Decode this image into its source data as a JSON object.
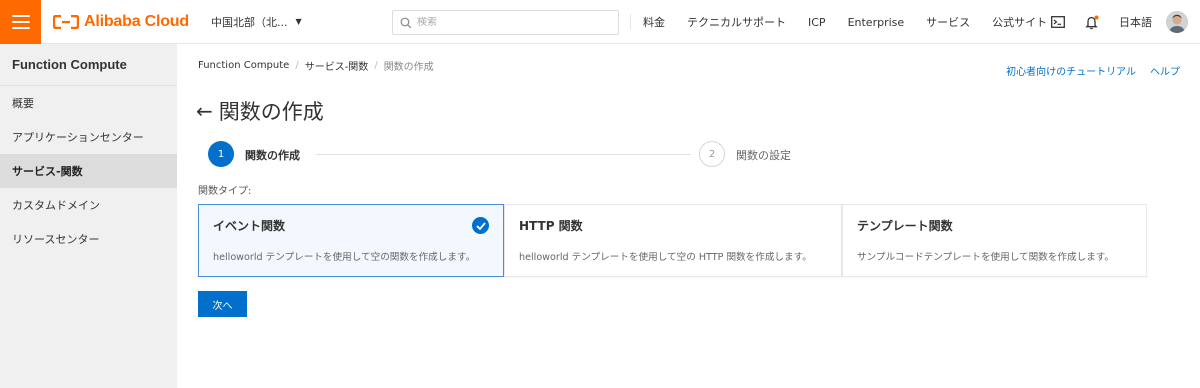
{
  "header": {
    "brand": "Alibaba Cloud",
    "region": "中国北部（北...",
    "search_placeholder": "検索",
    "nav": [
      "料金",
      "テクニカルサポート",
      "ICP",
      "Enterprise",
      "サービス",
      "公式サイト"
    ],
    "language": "日本語",
    "icons": [
      "menu-icon",
      "terminal-icon",
      "bell-icon",
      "avatar"
    ],
    "brand_color": "#ff6a00",
    "notification_dot_color": "#ff6a00"
  },
  "sidebar": {
    "title": "Function Compute",
    "items": [
      {
        "label": "概要"
      },
      {
        "label": "アプリケーションセンター"
      },
      {
        "label": "サービス-関数"
      },
      {
        "label": "カスタムドメイン"
      },
      {
        "label": "リソースセンター"
      }
    ],
    "active_item": "サービス-関数",
    "collapse_icon": "chevron-left-icon"
  },
  "breadcrumb": {
    "items": [
      "Function Compute",
      "サービス-関数",
      "関数の作成"
    ],
    "separator": "/"
  },
  "top_links": {
    "tutorial": "初心者向けのチュートリアル",
    "help": "ヘルプ"
  },
  "page": {
    "title": "関数の作成",
    "back_icon": "arrow-left-icon"
  },
  "steps": [
    {
      "number": "1",
      "label": "関数の作成",
      "state": "active"
    },
    {
      "number": "2",
      "label": "関数の設定",
      "state": "inactive"
    }
  ],
  "function_type": {
    "label": "関数タイプ:",
    "cards": [
      {
        "title": "イベント関数",
        "description": "helloworld テンプレートを使用して空の関数を作成します。",
        "selected": true
      },
      {
        "title": "HTTP 関数",
        "description": "helloworld テンプレートを使用して空の HTTP 関数を作成します。",
        "selected": false
      },
      {
        "title": "テンプレート関数",
        "description": "サンプルコードテンプレートを使用して関数を作成します。",
        "selected": false
      }
    ]
  },
  "actions": {
    "next": "次へ"
  },
  "colors": {
    "primary": "#0070cc",
    "accent": "#ff6a00",
    "selected_card_border": "#4a90d9"
  }
}
